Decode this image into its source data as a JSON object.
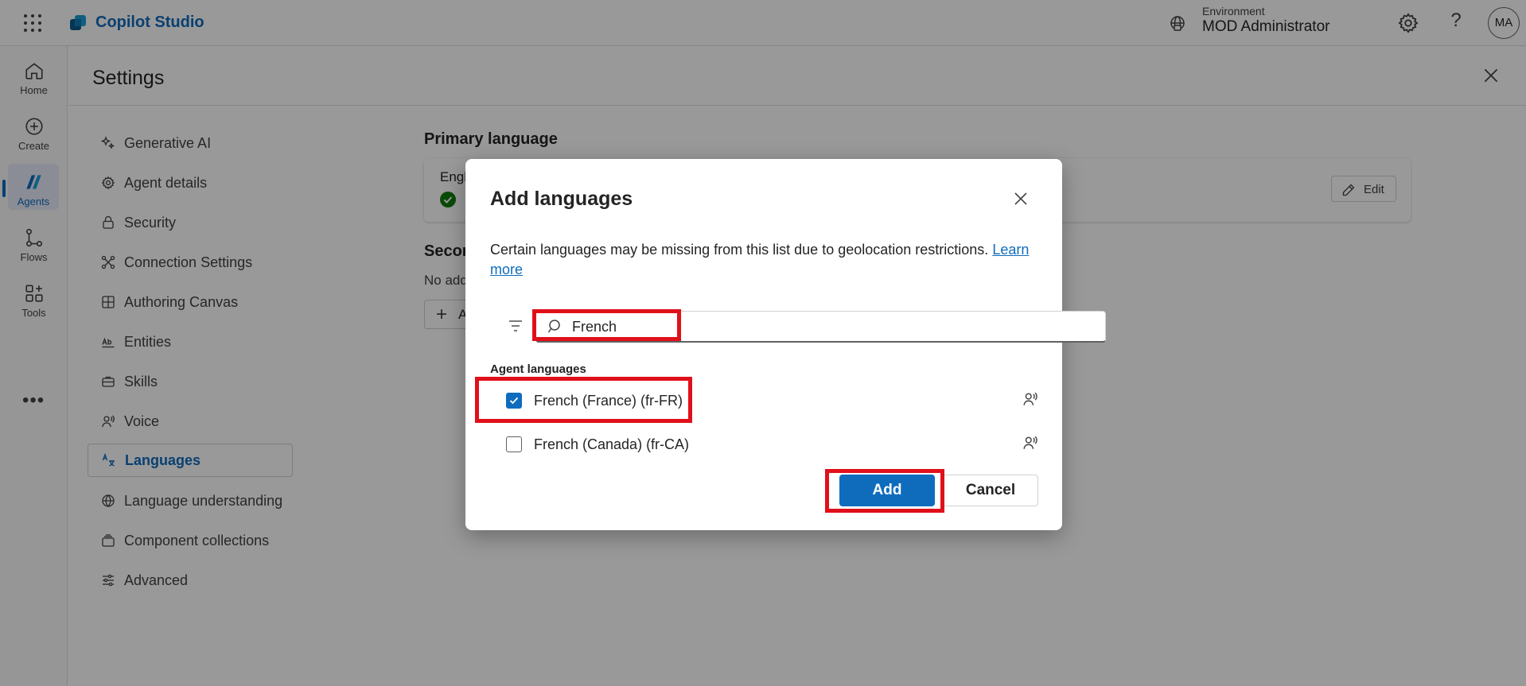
{
  "app": {
    "name": "Copilot Studio",
    "environment_label": "Environment",
    "environment_value": "MOD Administrator",
    "avatar_initials": "MA",
    "help_glyph": "?"
  },
  "rail": {
    "items": [
      {
        "label": "Home",
        "icon": "home-icon"
      },
      {
        "label": "Create",
        "icon": "plus-circle-icon"
      },
      {
        "label": "Agents",
        "icon": "agents-icon",
        "active": true
      },
      {
        "label": "Flows",
        "icon": "flow-icon"
      },
      {
        "label": "Tools",
        "icon": "tools-icon"
      }
    ],
    "more": "•••"
  },
  "settings": {
    "title": "Settings",
    "nav": [
      {
        "label": "Generative AI",
        "icon": "sparkle-icon"
      },
      {
        "label": "Agent details",
        "icon": "gear-icon"
      },
      {
        "label": "Security",
        "icon": "lock-icon"
      },
      {
        "label": "Connection Settings",
        "icon": "connection-icon"
      },
      {
        "label": "Authoring Canvas",
        "icon": "grid-icon"
      },
      {
        "label": "Entities",
        "icon": "entity-icon"
      },
      {
        "label": "Skills",
        "icon": "briefcase-icon"
      },
      {
        "label": "Voice",
        "icon": "voice-icon"
      },
      {
        "label": "Languages",
        "icon": "translate-icon",
        "active": true
      },
      {
        "label": "Language understanding",
        "icon": "globe-icon"
      },
      {
        "label": "Component collections",
        "icon": "collection-icon"
      },
      {
        "label": "Advanced",
        "icon": "sliders-icon"
      }
    ]
  },
  "content": {
    "primary_heading": "Primary language",
    "primary_language_partial": "Engl",
    "edit_label": "Edit",
    "secondary_heading_partial": "Secon",
    "secondary_empty_partial": "No add",
    "add_button_partial": "A"
  },
  "dialog": {
    "title": "Add languages",
    "description": "Certain languages may be missing from this list due to geolocation restrictions.",
    "learn_more": "Learn more",
    "search_value": "French",
    "group_label": "Agent languages",
    "languages": [
      {
        "name": "French (France) (fr-FR)",
        "checked": true
      },
      {
        "name": "French (Canada) (fr-CA)",
        "checked": false
      }
    ],
    "add_label": "Add",
    "cancel_label": "Cancel"
  },
  "colors": {
    "accent": "#0f6cbd",
    "highlight": "#e0101b",
    "success": "#107c10"
  }
}
